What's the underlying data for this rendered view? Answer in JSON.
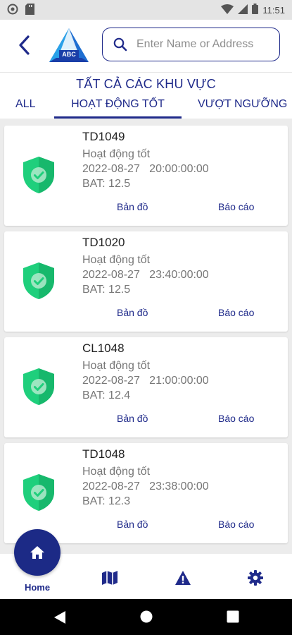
{
  "status_bar": {
    "time": "11:51",
    "icons": [
      "sync-circle-icon",
      "sd-card-icon",
      "wifi-icon",
      "signal-icon",
      "battery-icon"
    ]
  },
  "header": {
    "logo_text": "ABC",
    "search": {
      "placeholder": "Enter Name or Address",
      "value": ""
    }
  },
  "region": {
    "title": "TẤT CẢ CÁC KHU VỰC",
    "tabs": [
      {
        "label": "ALL",
        "active": false
      },
      {
        "label": "HOẠT ĐỘNG TỐT",
        "active": true
      },
      {
        "label": "VƯỢT NGƯỠNG",
        "active": false
      }
    ]
  },
  "devices": [
    {
      "id": "TD1049",
      "status": "Hoạt động tốt",
      "time": "2022-08-27   20:00:00:00",
      "bat": "BAT: 12.5",
      "map_link": "Bản đồ",
      "report_link": "Báo cáo"
    },
    {
      "id": "TD1020",
      "status": "Hoạt động tốt",
      "time": "2022-08-27   23:40:00:00",
      "bat": "BAT: 12.5",
      "map_link": "Bản đồ",
      "report_link": "Báo cáo"
    },
    {
      "id": "CL1048",
      "status": "Hoạt động tốt",
      "time": "2022-08-27   21:00:00:00",
      "bat": "BAT: 12.4",
      "map_link": "Bản đồ",
      "report_link": "Báo cáo"
    },
    {
      "id": "TD1048",
      "status": "Hoạt động tốt",
      "time": "2022-08-27   23:38:00:00",
      "bat": "BAT: 12.3",
      "map_link": "Bản đồ",
      "report_link": "Báo cáo"
    }
  ],
  "bottom_nav": {
    "home_label": "Home",
    "items": [
      "home-icon",
      "map-icon",
      "warning-icon",
      "settings-icon"
    ]
  },
  "colors": {
    "primary": "#1f2a8a",
    "shield_green": "#1fcf7c",
    "shield_dark": "#17a862"
  }
}
